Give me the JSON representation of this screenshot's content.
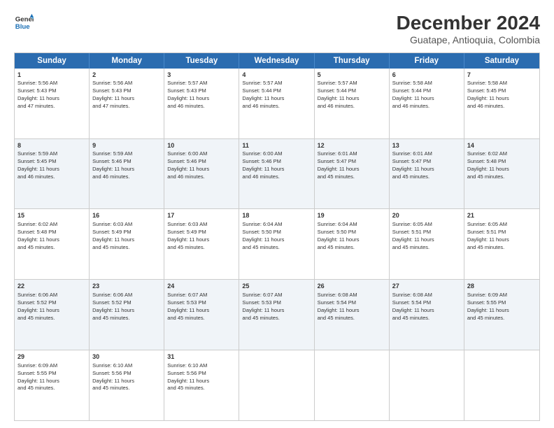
{
  "header": {
    "logo_line1": "General",
    "logo_line2": "Blue",
    "title": "December 2024",
    "subtitle": "Guatape, Antioquia, Colombia"
  },
  "calendar": {
    "weekdays": [
      "Sunday",
      "Monday",
      "Tuesday",
      "Wednesday",
      "Thursday",
      "Friday",
      "Saturday"
    ],
    "rows": [
      {
        "alt": false,
        "cells": [
          {
            "day": 1,
            "info": "Sunrise: 5:56 AM\nSunset: 5:43 PM\nDaylight: 11 hours\nand 47 minutes."
          },
          {
            "day": 2,
            "info": "Sunrise: 5:56 AM\nSunset: 5:43 PM\nDaylight: 11 hours\nand 47 minutes."
          },
          {
            "day": 3,
            "info": "Sunrise: 5:57 AM\nSunset: 5:43 PM\nDaylight: 11 hours\nand 46 minutes."
          },
          {
            "day": 4,
            "info": "Sunrise: 5:57 AM\nSunset: 5:44 PM\nDaylight: 11 hours\nand 46 minutes."
          },
          {
            "day": 5,
            "info": "Sunrise: 5:57 AM\nSunset: 5:44 PM\nDaylight: 11 hours\nand 46 minutes."
          },
          {
            "day": 6,
            "info": "Sunrise: 5:58 AM\nSunset: 5:44 PM\nDaylight: 11 hours\nand 46 minutes."
          },
          {
            "day": 7,
            "info": "Sunrise: 5:58 AM\nSunset: 5:45 PM\nDaylight: 11 hours\nand 46 minutes."
          }
        ]
      },
      {
        "alt": true,
        "cells": [
          {
            "day": 8,
            "info": "Sunrise: 5:59 AM\nSunset: 5:45 PM\nDaylight: 11 hours\nand 46 minutes."
          },
          {
            "day": 9,
            "info": "Sunrise: 5:59 AM\nSunset: 5:46 PM\nDaylight: 11 hours\nand 46 minutes."
          },
          {
            "day": 10,
            "info": "Sunrise: 6:00 AM\nSunset: 5:46 PM\nDaylight: 11 hours\nand 46 minutes."
          },
          {
            "day": 11,
            "info": "Sunrise: 6:00 AM\nSunset: 5:46 PM\nDaylight: 11 hours\nand 46 minutes."
          },
          {
            "day": 12,
            "info": "Sunrise: 6:01 AM\nSunset: 5:47 PM\nDaylight: 11 hours\nand 45 minutes."
          },
          {
            "day": 13,
            "info": "Sunrise: 6:01 AM\nSunset: 5:47 PM\nDaylight: 11 hours\nand 45 minutes."
          },
          {
            "day": 14,
            "info": "Sunrise: 6:02 AM\nSunset: 5:48 PM\nDaylight: 11 hours\nand 45 minutes."
          }
        ]
      },
      {
        "alt": false,
        "cells": [
          {
            "day": 15,
            "info": "Sunrise: 6:02 AM\nSunset: 5:48 PM\nDaylight: 11 hours\nand 45 minutes."
          },
          {
            "day": 16,
            "info": "Sunrise: 6:03 AM\nSunset: 5:49 PM\nDaylight: 11 hours\nand 45 minutes."
          },
          {
            "day": 17,
            "info": "Sunrise: 6:03 AM\nSunset: 5:49 PM\nDaylight: 11 hours\nand 45 minutes."
          },
          {
            "day": 18,
            "info": "Sunrise: 6:04 AM\nSunset: 5:50 PM\nDaylight: 11 hours\nand 45 minutes."
          },
          {
            "day": 19,
            "info": "Sunrise: 6:04 AM\nSunset: 5:50 PM\nDaylight: 11 hours\nand 45 minutes."
          },
          {
            "day": 20,
            "info": "Sunrise: 6:05 AM\nSunset: 5:51 PM\nDaylight: 11 hours\nand 45 minutes."
          },
          {
            "day": 21,
            "info": "Sunrise: 6:05 AM\nSunset: 5:51 PM\nDaylight: 11 hours\nand 45 minutes."
          }
        ]
      },
      {
        "alt": true,
        "cells": [
          {
            "day": 22,
            "info": "Sunrise: 6:06 AM\nSunset: 5:52 PM\nDaylight: 11 hours\nand 45 minutes."
          },
          {
            "day": 23,
            "info": "Sunrise: 6:06 AM\nSunset: 5:52 PM\nDaylight: 11 hours\nand 45 minutes."
          },
          {
            "day": 24,
            "info": "Sunrise: 6:07 AM\nSunset: 5:53 PM\nDaylight: 11 hours\nand 45 minutes."
          },
          {
            "day": 25,
            "info": "Sunrise: 6:07 AM\nSunset: 5:53 PM\nDaylight: 11 hours\nand 45 minutes."
          },
          {
            "day": 26,
            "info": "Sunrise: 6:08 AM\nSunset: 5:54 PM\nDaylight: 11 hours\nand 45 minutes."
          },
          {
            "day": 27,
            "info": "Sunrise: 6:08 AM\nSunset: 5:54 PM\nDaylight: 11 hours\nand 45 minutes."
          },
          {
            "day": 28,
            "info": "Sunrise: 6:09 AM\nSunset: 5:55 PM\nDaylight: 11 hours\nand 45 minutes."
          }
        ]
      },
      {
        "alt": false,
        "cells": [
          {
            "day": 29,
            "info": "Sunrise: 6:09 AM\nSunset: 5:55 PM\nDaylight: 11 hours\nand 45 minutes."
          },
          {
            "day": 30,
            "info": "Sunrise: 6:10 AM\nSunset: 5:56 PM\nDaylight: 11 hours\nand 45 minutes."
          },
          {
            "day": 31,
            "info": "Sunrise: 6:10 AM\nSunset: 5:56 PM\nDaylight: 11 hours\nand 45 minutes."
          },
          {
            "day": null,
            "info": ""
          },
          {
            "day": null,
            "info": ""
          },
          {
            "day": null,
            "info": ""
          },
          {
            "day": null,
            "info": ""
          }
        ]
      }
    ]
  }
}
